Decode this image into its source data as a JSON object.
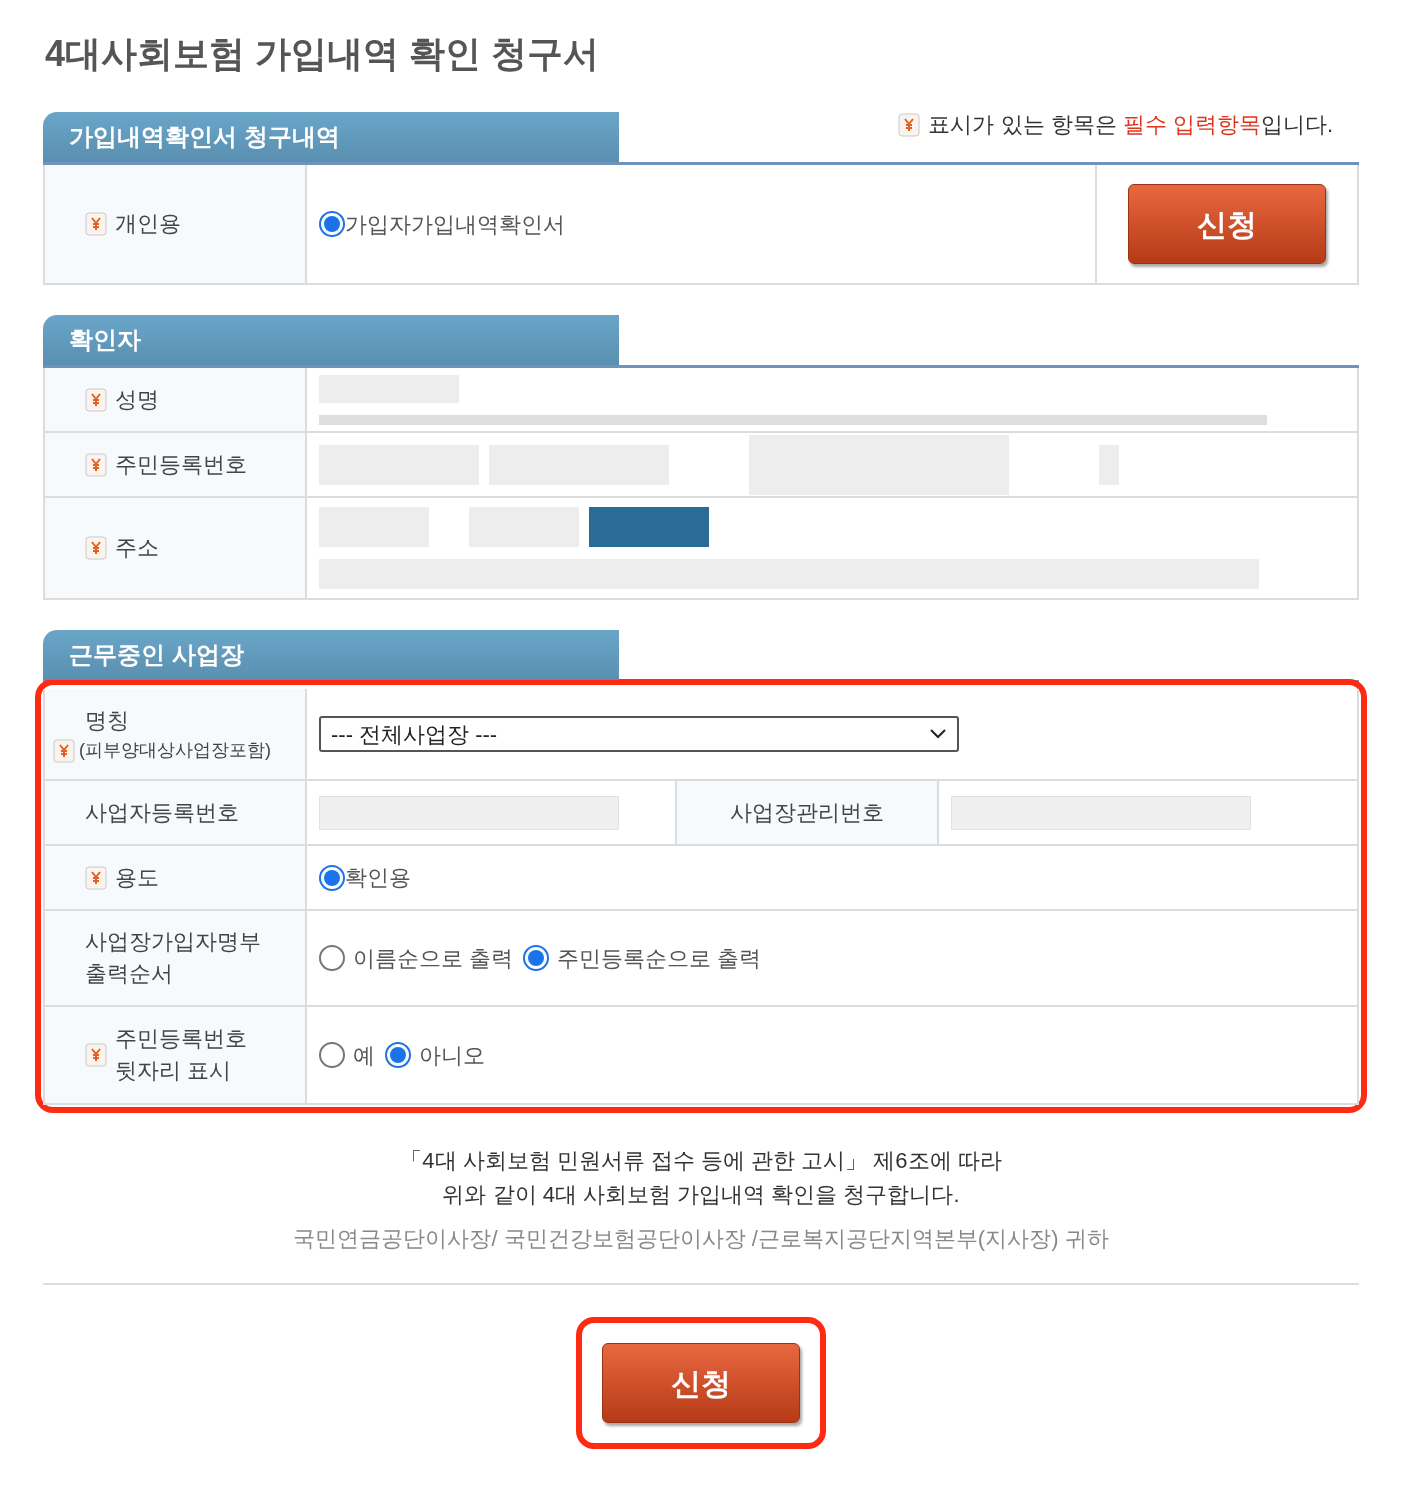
{
  "title": "4대사회보험 가입내역 확인 청구서",
  "required_note": {
    "prefix": "표시가 있는 항목은 ",
    "highlight": "필수 입력항목",
    "suffix": "입니다."
  },
  "request_section": {
    "title": "가입내역확인서 청구내역",
    "label": "개인용",
    "required": true,
    "options": [
      {
        "label": "가입자가입내역확인서",
        "selected": true
      }
    ],
    "button": "신청"
  },
  "verifier_section": {
    "title": "확인자",
    "rows": [
      {
        "kind": "name",
        "label": "성명",
        "required": true
      },
      {
        "kind": "id_number",
        "label": "주민등록번호",
        "required": true
      },
      {
        "kind": "address",
        "label": "주소",
        "required": true
      }
    ]
  },
  "workplace_section": {
    "title": "근무중인 사업장",
    "highlighted": true,
    "rows": [
      {
        "kind": "select",
        "label": "명칭",
        "sublabel": "(피부양대상사업장포함)",
        "required": true,
        "value": "--- 전체사업장 ---"
      },
      {
        "kind": "pair",
        "label": "사업자등록번호",
        "required": false,
        "label_2": "사업장관리번호"
      },
      {
        "kind": "radio",
        "label": "용도",
        "required": true,
        "options": [
          {
            "label": "확인용",
            "selected": true
          }
        ]
      },
      {
        "kind": "radio",
        "label": "사업장가입자명부 출력순서",
        "required": false,
        "options": [
          {
            "label": "이름순으로 출력",
            "selected": false
          },
          {
            "label": "주민등록순으로 출력",
            "selected": true
          }
        ]
      },
      {
        "kind": "radio",
        "label": "주민등록번호 뒷자리 표시",
        "required": true,
        "options": [
          {
            "label": "예",
            "selected": false
          },
          {
            "label": "아니오",
            "selected": true
          }
        ]
      }
    ]
  },
  "notice": [
    "「4대 사회보험 민원서류 접수 등에 관한 고시」 제6조에 따라",
    "위와 같이 4대 사회보험 가입내역 확인을 청구합니다."
  ],
  "addressee": "국민연금공단이사장/ 국민건강보험공단이사장 /근로복지공단지역본부(지사장) 귀하",
  "submit": {
    "label": "신청",
    "highlighted": true
  }
}
